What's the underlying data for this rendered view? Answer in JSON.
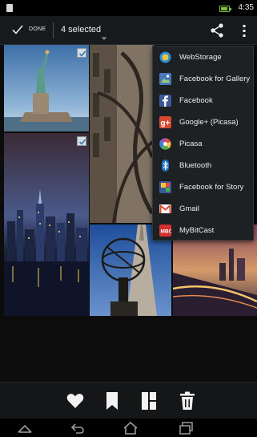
{
  "status_bar": {
    "time": "4:35"
  },
  "action_bar": {
    "done_label": "DONE",
    "selected_label": "4 selected"
  },
  "share_menu": {
    "items": [
      {
        "label": "WebStorage",
        "icon": "webstorage-icon"
      },
      {
        "label": "Facebook for Gallery",
        "icon": "facebook-gallery-icon"
      },
      {
        "label": "Facebook",
        "icon": "facebook-icon"
      },
      {
        "label": "Google+ (Picasa)",
        "icon": "googleplus-icon"
      },
      {
        "label": "Picasa",
        "icon": "picasa-icon"
      },
      {
        "label": "Bluetooth",
        "icon": "bluetooth-icon"
      },
      {
        "label": "Facebook for Story",
        "icon": "facebook-story-icon"
      },
      {
        "label": "Gmail",
        "icon": "gmail-icon"
      },
      {
        "label": "MyBitCast",
        "icon": "mybitcast-icon"
      }
    ]
  },
  "photos": [
    {
      "subject": "statue-of-liberty",
      "selected": true
    },
    {
      "subject": "atlas-sculpture-closeup",
      "selected": true
    },
    {
      "subject": "city-skyline-night",
      "selected": true
    },
    {
      "subject": "atlas-statue-cathedral",
      "selected": true
    },
    {
      "subject": "city-sunset-lights",
      "selected": false
    }
  ],
  "bottom_toolbar": {
    "buttons": [
      "favorite-icon",
      "bookmark-icon",
      "layout-icon",
      "delete-icon"
    ]
  },
  "nav_bar": {
    "buttons": [
      "recent-apps-icon",
      "back-icon",
      "home-icon",
      "overview-icon"
    ]
  },
  "colors": {
    "accent": "#33b5e5",
    "menu_bg": "#1d2124",
    "actionbar_bg": "#161a1c"
  }
}
